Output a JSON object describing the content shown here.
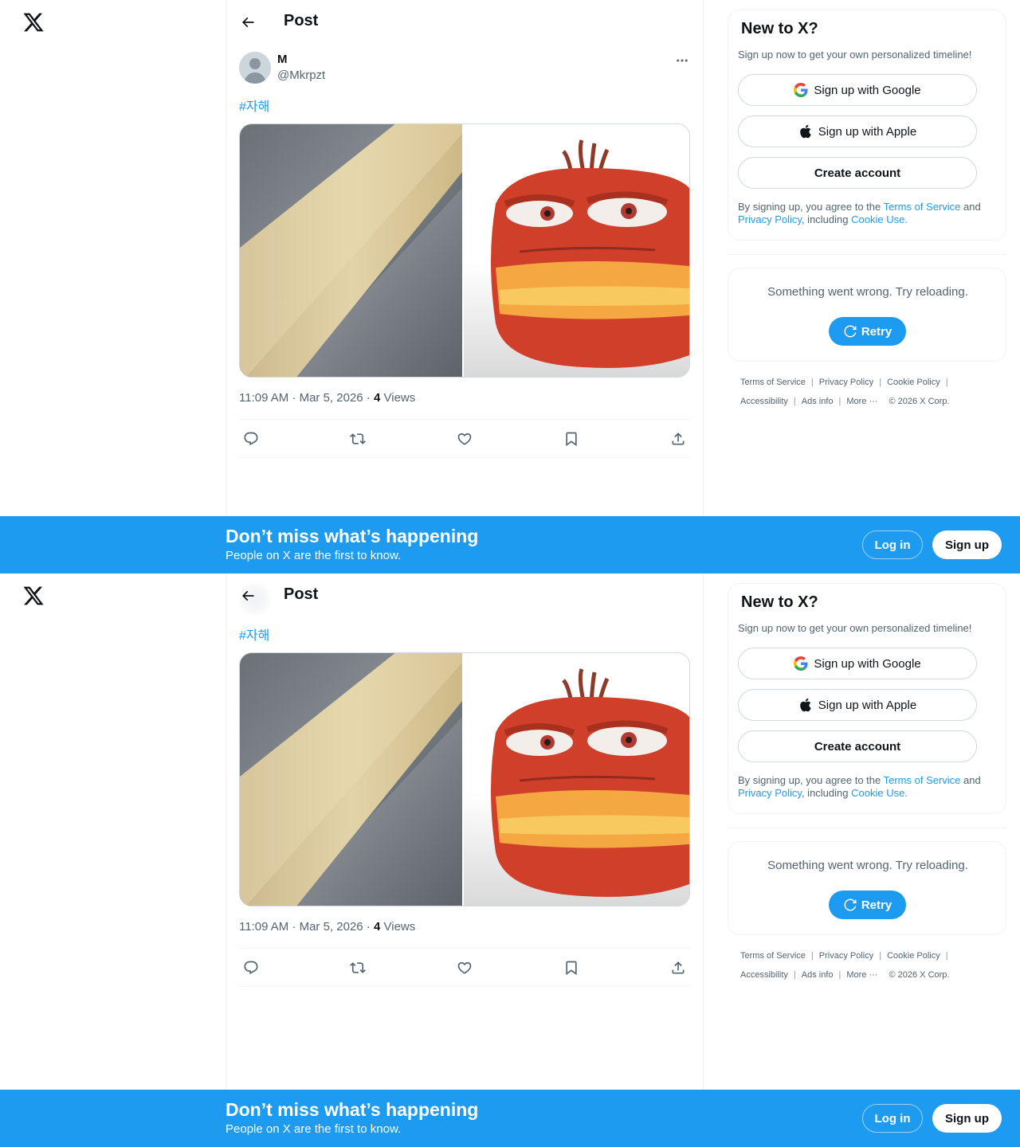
{
  "nav": {
    "back_label": "Post"
  },
  "post": {
    "author_name": "M",
    "author_handle": "@Mkrpzt",
    "hashtag": "#자해",
    "time": "11:09 AM · Mar 5, 2026",
    "views_count": "4",
    "views_label": "Views"
  },
  "signup": {
    "title": "New to X?",
    "subtitle": "Sign up now to get your own personalized timeline!",
    "google_label": "Sign up with Google",
    "apple_label": "Sign up with Apple",
    "create_label": "Create account",
    "terms_prefix": "By signing up, you agree to the ",
    "terms_link": "Terms of Service",
    "terms_and": " and ",
    "privacy_link": "Privacy Policy",
    "including": ", including ",
    "cookie_link": "Cookie Use."
  },
  "error": {
    "message": "Something went wrong. Try reloading.",
    "retry_label": "Retry"
  },
  "footer": {
    "terms": "Terms of Service",
    "privacy": "Privacy Policy",
    "cookie": "Cookie Policy",
    "accessibility": "Accessibility",
    "ads": "Ads info",
    "more": "More ···",
    "copyright": "© 2026 X Corp."
  },
  "banner": {
    "title": "Don’t miss what’s happening",
    "subtitle": "People on X are the first to know.",
    "login_label": "Log in",
    "signup_label": "Sign up"
  },
  "colors": {
    "accent": "#1d9bf0",
    "text": "#0f1419",
    "muted": "#536471"
  }
}
